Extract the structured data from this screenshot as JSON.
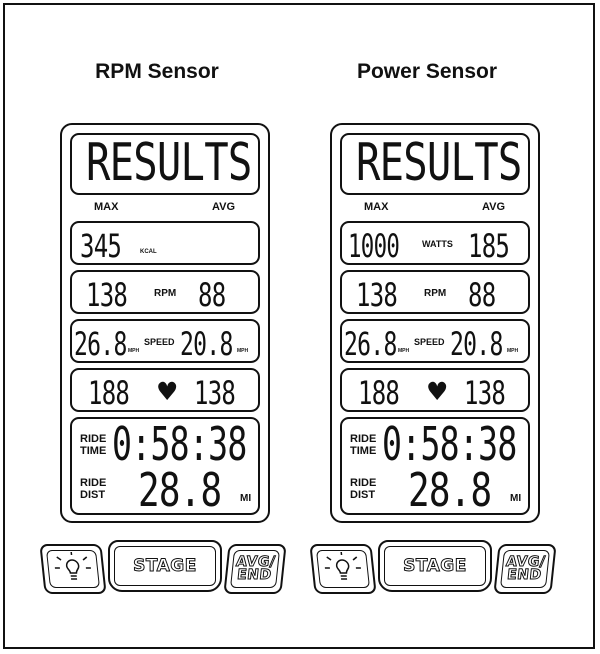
{
  "panels": [
    {
      "title": "RPM Sensor",
      "header": "RESULTS",
      "max_label": "MAX",
      "avg_label": "AVG",
      "row1": {
        "left": "345",
        "left_unit": "KCAL",
        "center": "",
        "right": ""
      },
      "row2": {
        "left": "138",
        "center": "RPM",
        "right": "88"
      },
      "row3": {
        "left": "26.8",
        "left_unit": "MPH",
        "center": "SPEED",
        "right": "20.8",
        "right_unit": "MPH"
      },
      "row4": {
        "left": "188",
        "right": "138"
      },
      "ride_time_label_1": "RIDE",
      "ride_time_label_2": "TIME",
      "ride_time": "0:58:38",
      "ride_dist_label_1": "RIDE",
      "ride_dist_label_2": "DIST",
      "ride_dist": "28.8",
      "ride_dist_unit": "MI",
      "buttons": {
        "stage": "STAGE",
        "avg_end_1": "AVG/",
        "avg_end_2": "END"
      }
    },
    {
      "title": "Power Sensor",
      "header": "RESULTS",
      "max_label": "MAX",
      "avg_label": "AVG",
      "row1": {
        "left": "1000",
        "left_unit": "",
        "center": "WATTS",
        "right": "185"
      },
      "row2": {
        "left": "138",
        "center": "RPM",
        "right": "88"
      },
      "row3": {
        "left": "26.8",
        "left_unit": "MPH",
        "center": "SPEED",
        "right": "20.8",
        "right_unit": "MPH"
      },
      "row4": {
        "left": "188",
        "right": "138"
      },
      "ride_time_label_1": "RIDE",
      "ride_time_label_2": "TIME",
      "ride_time": "0:58:38",
      "ride_dist_label_1": "RIDE",
      "ride_dist_label_2": "DIST",
      "ride_dist": "28.8",
      "ride_dist_unit": "MI",
      "buttons": {
        "stage": "STAGE",
        "avg_end_1": "AVG/",
        "avg_end_2": "END"
      }
    }
  ]
}
